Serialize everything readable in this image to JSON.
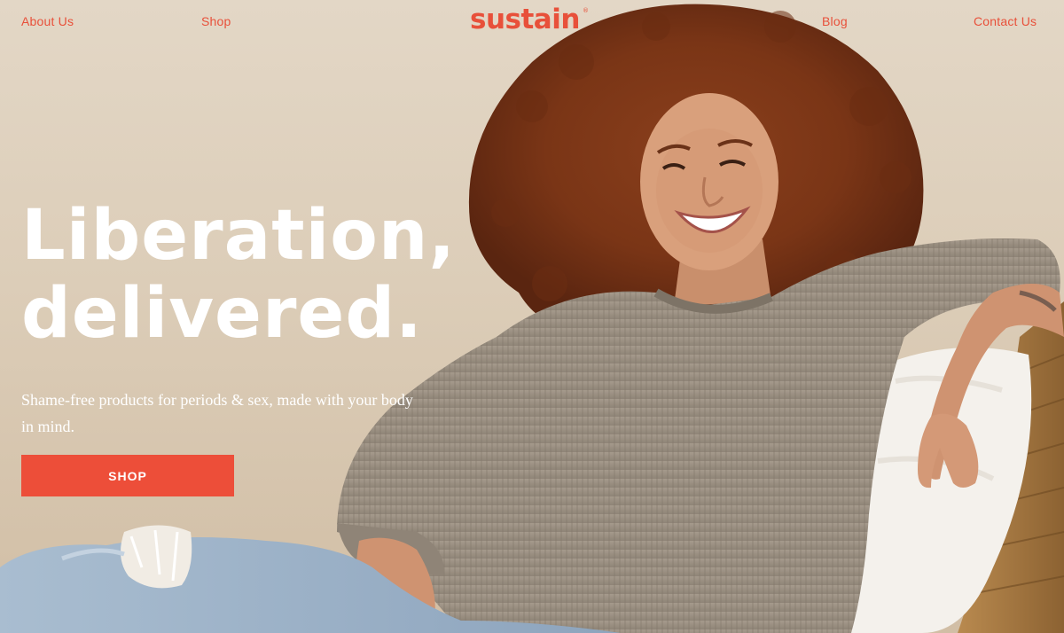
{
  "nav": {
    "about_label": "About Us",
    "shop_label": "Shop",
    "blog_label": "Blog",
    "contact_label": "Contact Us"
  },
  "brand": {
    "logo_text": "sustain",
    "registered_mark": "®"
  },
  "hero": {
    "headline_line1": "Liberation,",
    "headline_line2": "delivered.",
    "subheadline": "Shame-free products for periods & sex, made with your body in mind.",
    "cta_label": "SHOP"
  },
  "colors": {
    "brand_accent": "#e8503a",
    "cta_background": "#ed4e39",
    "hero_text": "#ffffff",
    "background": "#dccdb8"
  },
  "icons": {
    "photo": "hero-photo-smiling-woman-icon"
  }
}
